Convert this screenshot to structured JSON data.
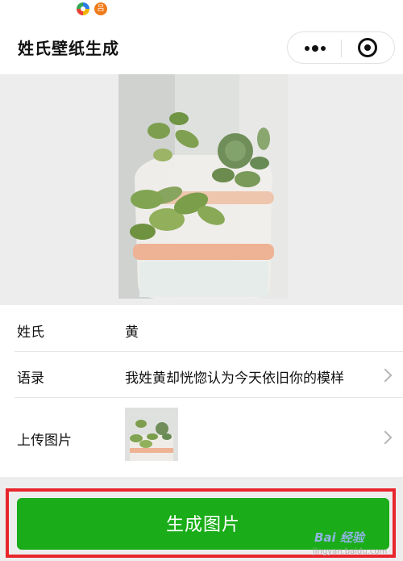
{
  "status_bar": {
    "icons": [
      "app-icon",
      "notification-icon"
    ],
    "badge": "吕"
  },
  "navbar": {
    "title": "姓氏壁纸生成",
    "more_icon": "more-dots-icon",
    "close_icon": "target-close-icon"
  },
  "preview": {
    "description_icon": "succulent-plant-image"
  },
  "form": {
    "surname": {
      "label": "姓氏",
      "value": "黄"
    },
    "quote": {
      "label": "语录",
      "value": "我姓黄却恍惚认为今天依旧你的模样"
    },
    "upload": {
      "label": "上传图片",
      "thumbnail_icon": "succulent-thumbnail-image"
    }
  },
  "primary_button": {
    "label": "生成图片"
  },
  "colors": {
    "button": "#1aad19",
    "highlight": "#e8262c",
    "background": "#ededed"
  },
  "watermark": {
    "main": "Bai 经验",
    "sub": "jingyan.baidu.com"
  }
}
